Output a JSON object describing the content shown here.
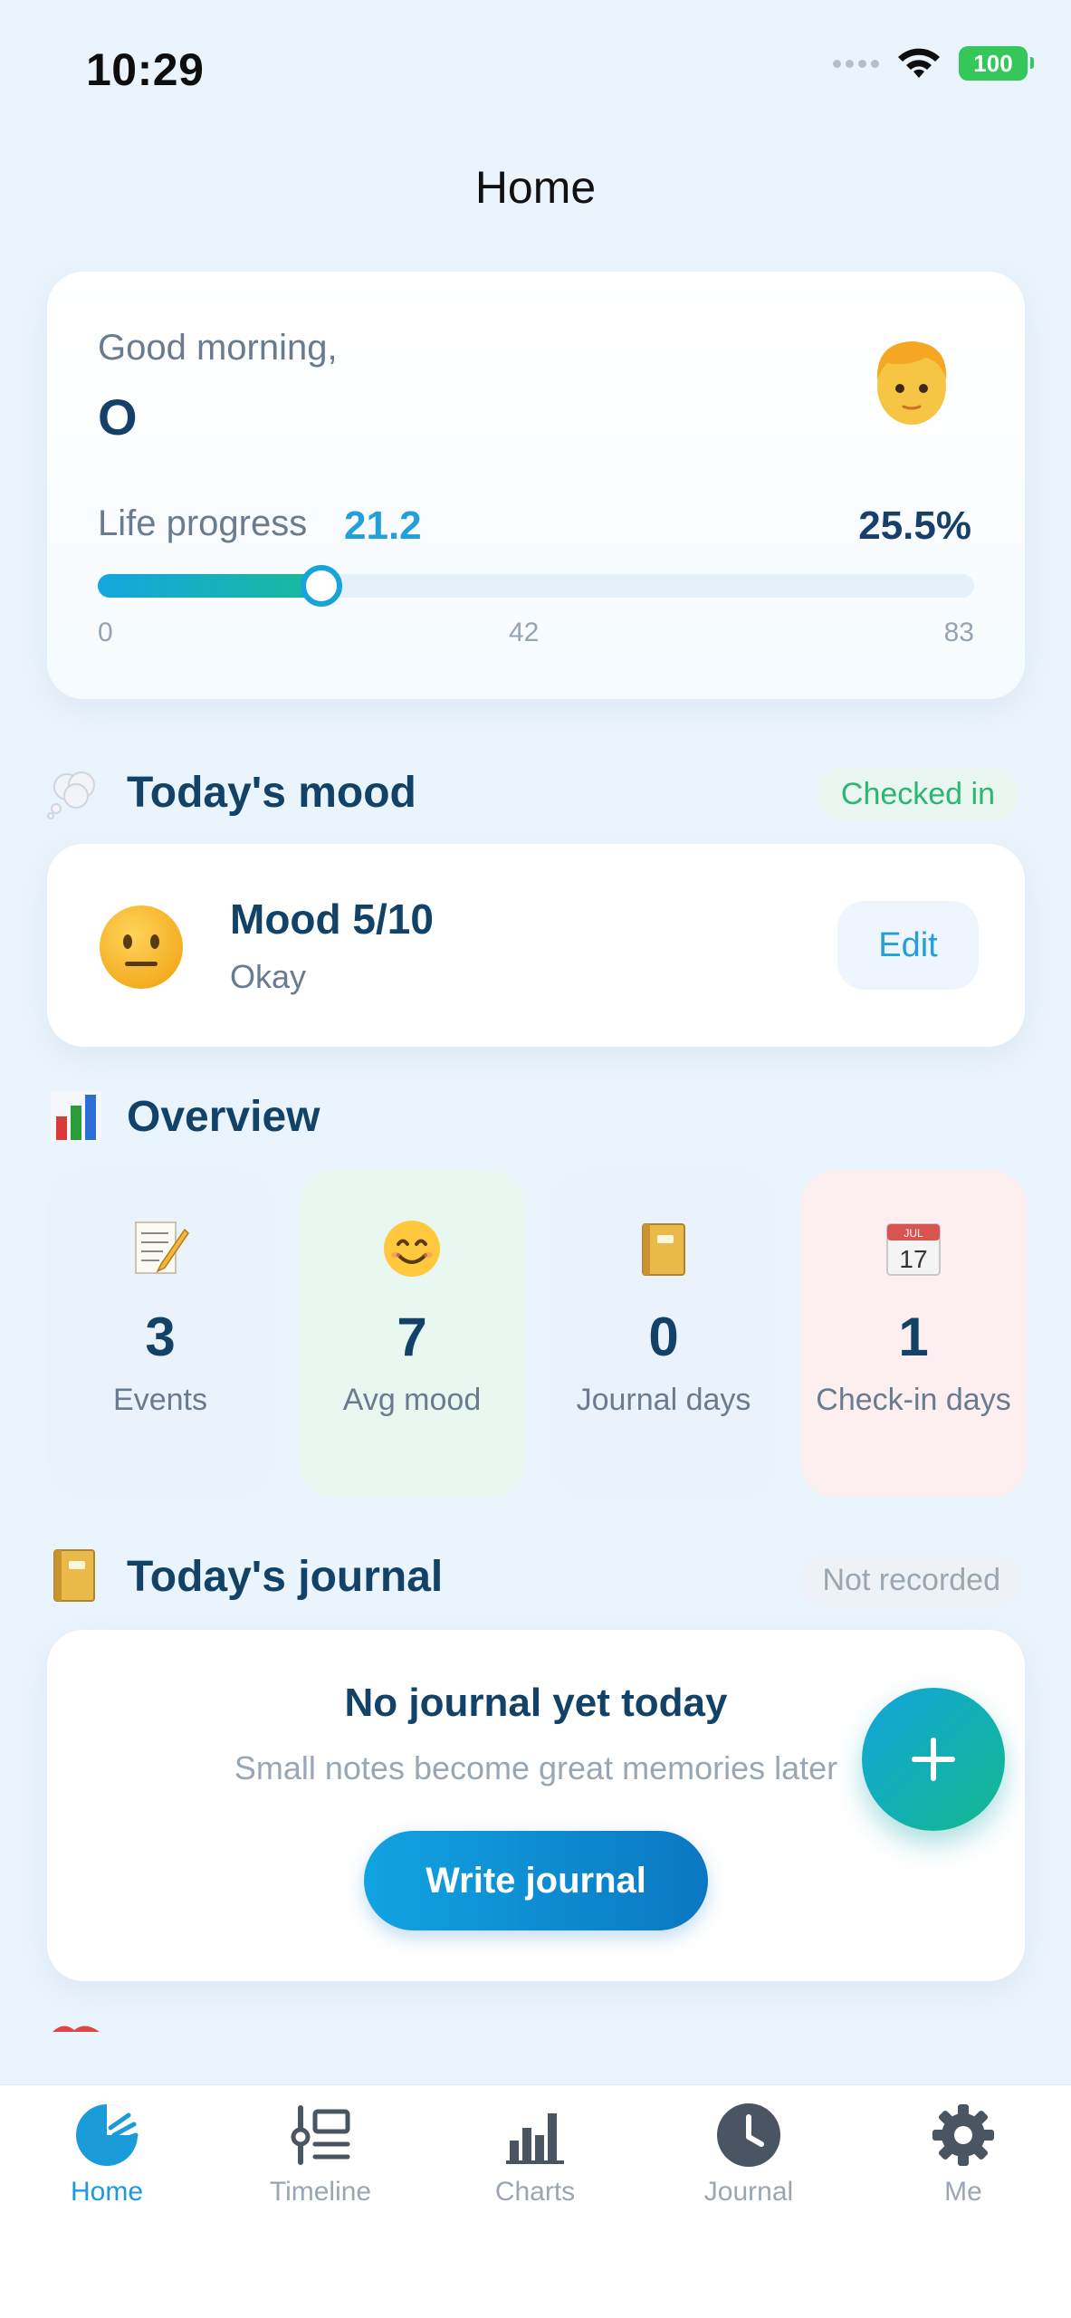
{
  "status_bar": {
    "time": "10:29",
    "battery": "100"
  },
  "header": {
    "title": "Home"
  },
  "greeting": {
    "salutation": "Good morning,",
    "name": "O",
    "progress_label": "Life progress",
    "progress_value": "21.2",
    "progress_percent": "25.5%",
    "progress_fraction": 0.255,
    "ticks": [
      "0",
      "42",
      "83"
    ]
  },
  "mood": {
    "section_title": "Today's mood",
    "status": "Checked in",
    "title": "Mood 5/10",
    "subtitle": "Okay",
    "edit_label": "Edit"
  },
  "overview": {
    "section_title": "Overview",
    "tiles": [
      {
        "value": "3",
        "label": "Events",
        "icon": "memo-icon",
        "bg": "#eaf3fc"
      },
      {
        "value": "7",
        "label": "Avg mood",
        "icon": "smile-icon",
        "bg": "#e8f8f1"
      },
      {
        "value": "0",
        "label": "Journal days",
        "icon": "notebook-icon",
        "bg": "#eaf3fc"
      },
      {
        "value": "1",
        "label": "Check-in days",
        "icon": "calendar-icon",
        "bg": "#fdeef0"
      }
    ]
  },
  "journal": {
    "section_title": "Today's journal",
    "status": "Not recorded",
    "empty_title": "No journal yet today",
    "empty_subtitle": "Small notes become great memories later",
    "button_label": "Write journal"
  },
  "tabs": [
    {
      "label": "Home",
      "icon": "home-pie-icon",
      "active": true
    },
    {
      "label": "Timeline",
      "icon": "timeline-icon",
      "active": false
    },
    {
      "label": "Charts",
      "icon": "bar-chart-icon",
      "active": false
    },
    {
      "label": "Journal",
      "icon": "clock-icon",
      "active": false
    },
    {
      "label": "Me",
      "icon": "gear-icon",
      "active": false
    }
  ],
  "colors": {
    "accent": "#1c9bd9",
    "success": "#2bb673",
    "dark_text": "#134268"
  }
}
